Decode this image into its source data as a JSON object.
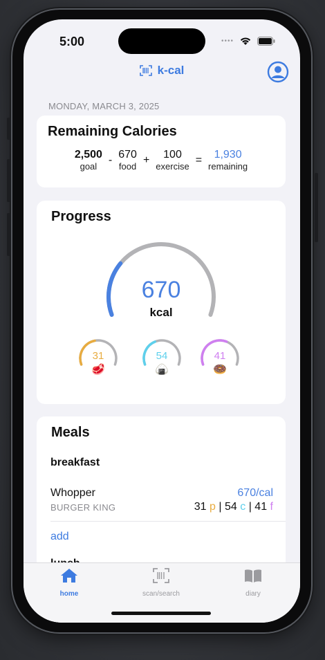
{
  "status_bar": {
    "time": "5:00"
  },
  "header": {
    "title": "k-cal"
  },
  "date": "MONDAY, MARCH 3, 2025",
  "remaining": {
    "title": "Remaining Calories",
    "goal": {
      "value": "2,500",
      "label": "goal"
    },
    "food": {
      "value": "670",
      "label": "food"
    },
    "exercise": {
      "value": "100",
      "label": "exercise"
    },
    "result": {
      "value": "1,930",
      "label": "remaining"
    },
    "op_minus": "-",
    "op_plus": "+",
    "op_equals": "="
  },
  "progress": {
    "title": "Progress",
    "kcal_value": "670",
    "kcal_unit": "kcal",
    "kcal_fraction": 0.27,
    "macros": [
      {
        "name": "protein",
        "value": "31",
        "color": "#e8ac40",
        "icon": "steak-icon",
        "glyph": "🥩",
        "fraction": 0.45
      },
      {
        "name": "carbs",
        "value": "54",
        "color": "#5ed0ec",
        "icon": "rice-icon",
        "glyph": "🍙",
        "fraction": 0.4
      },
      {
        "name": "fat",
        "value": "41",
        "color": "#cf7ff0",
        "icon": "donut-icon",
        "glyph": "🍩",
        "fraction": 0.6
      }
    ]
  },
  "meals": {
    "title": "Meals",
    "breakfast": {
      "label": "breakfast",
      "item": {
        "name": "Whopper",
        "brand": "BURGER KING",
        "calories": "670/cal",
        "protein": "31",
        "protein_unit": "p",
        "carbs": "54",
        "carbs_unit": "c",
        "fat": "41",
        "fat_unit": "f",
        "sep": "|"
      },
      "add_label": "add"
    },
    "next_meal_peek": "lunch"
  },
  "tabs": [
    {
      "label": "home",
      "icon": "house-icon",
      "active": true
    },
    {
      "label": "scan/search",
      "icon": "barcode-scan-icon",
      "active": false
    },
    {
      "label": "diary",
      "icon": "book-icon",
      "active": false
    }
  ],
  "colors": {
    "accent": "#3d7be0",
    "inactive": "#9b9b9f",
    "track": "#b3b3b6"
  }
}
